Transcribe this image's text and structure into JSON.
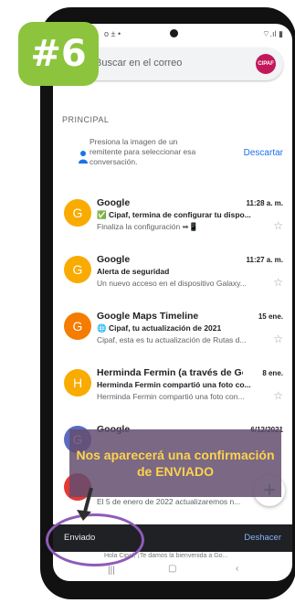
{
  "badge": "#6",
  "status": {
    "left": "o ± •",
    "right": "⌔.ıl ▮"
  },
  "search": {
    "placeholder": "Buscar en el correo",
    "avatar_label": "CIPAF"
  },
  "section_label": "PRINCIPAL",
  "tip": {
    "text": "Presiona la imagen de un remitente para seleccionar esa conversación.",
    "action": "Descartar"
  },
  "emails": [
    {
      "avatar": "G",
      "avatar_color": "#f9ab00",
      "sender": "Google",
      "time": "11:28 a. m.",
      "subject": "✅ Cipaf, termina de configurar tu dispo...",
      "snippet": "Finaliza la configuración ➡📱"
    },
    {
      "avatar": "G",
      "avatar_color": "#f9ab00",
      "sender": "Google",
      "time": "11:27 a. m.",
      "subject": "Alerta de seguridad",
      "snippet": "Un nuevo acceso en el dispositivo Galaxy..."
    },
    {
      "avatar": "G",
      "avatar_color": "#f57c00",
      "sender": "Google Maps Timeline",
      "time": "15 ene.",
      "subject": "🌐 Cipaf, tu actualización de 2021",
      "snippet": "Cipaf, esta es tu actualización de Rutas d..."
    },
    {
      "avatar": "H",
      "avatar_color": "#f9ab00",
      "sender": "Herminda Fermin (a través de Go...",
      "time": "8 ene.",
      "subject": "Herminda Fermin compartió una foto co...",
      "snippet": "Herminda Fermin compartió una foto con..."
    },
    {
      "avatar": "G",
      "avatar_color": "#5c6bc0",
      "sender": "Google",
      "time": "6/12/2021",
      "subject": "",
      "snippet": ""
    }
  ],
  "partial_snippet": "El 5 de enero de 2022 actualizaremos n...",
  "overlay_text": "Nos aparecerá una confirmación de ENVIADO",
  "snackbar": {
    "message": "Enviado",
    "action": "Deshacer"
  },
  "peek_text": "Hola Cipaf, ¡Te damos la bienvenida a Go...",
  "colors": {
    "badge": "#8cc43d",
    "overlay": "#634d70",
    "overlay_text": "#ffd24a",
    "ring": "#8e5bb8",
    "link": "#1a73e8"
  }
}
